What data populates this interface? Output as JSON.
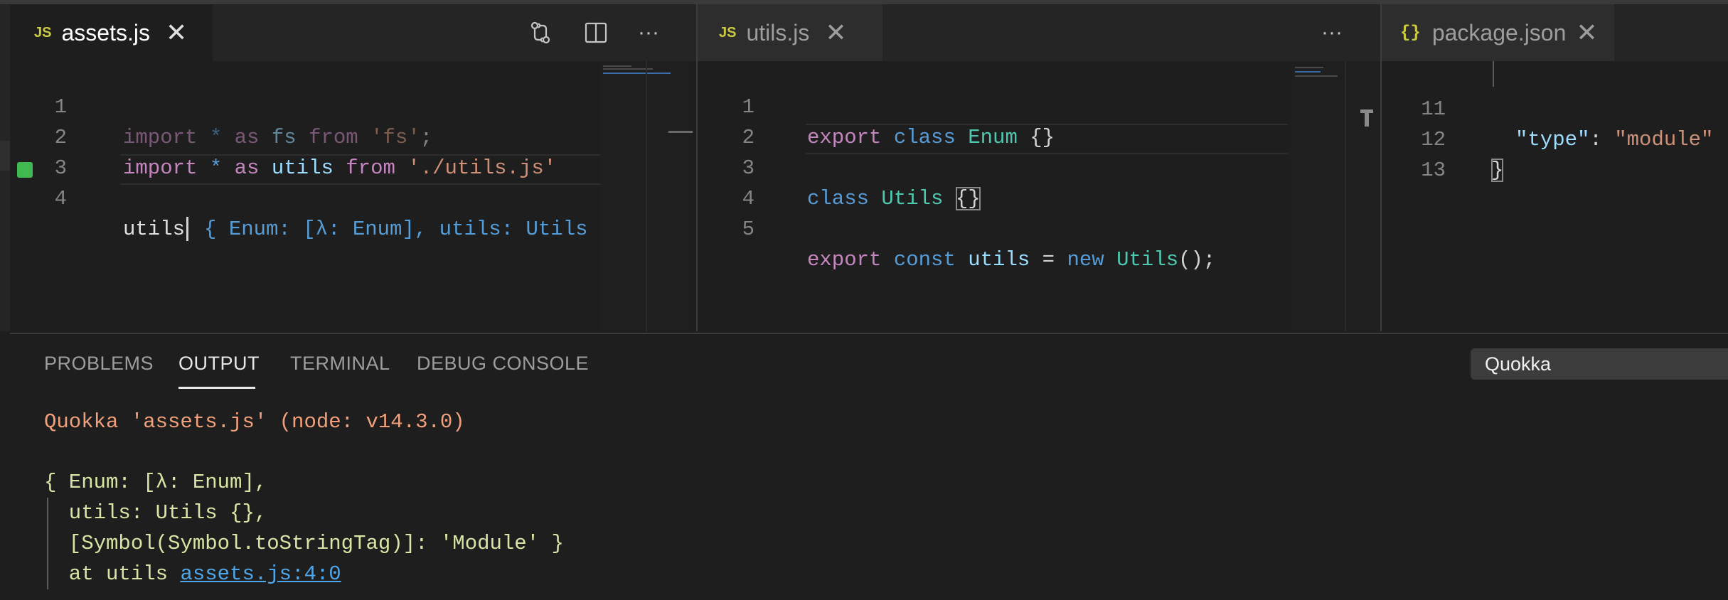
{
  "editor_a": {
    "tab": {
      "icon": "JS",
      "label": "assets.js",
      "close": "✕"
    },
    "actions": {
      "compare": "⇄",
      "split": "split-editor",
      "more": "···"
    },
    "lines": [
      {
        "n": "1"
      },
      {
        "n": "2"
      },
      {
        "n": "3"
      },
      {
        "n": "4"
      }
    ],
    "tokens": {
      "l1_import": "import",
      "l1_star": "*",
      "l1_as": "as",
      "l1_fs": "fs",
      "l1_from": "from",
      "l1_str": "'fs'",
      "l1_semi": ";",
      "l2_import": "import",
      "l2_star": "*",
      "l2_as": "as",
      "l2_utils": "utils",
      "l2_from": "from",
      "l2_str": "'./utils.js'",
      "l4_utils": "utils",
      "l4_hint": "{ Enum: [λ: Enum], utils: Utils"
    }
  },
  "editor_b": {
    "tab": {
      "icon": "JS",
      "label": "utils.js",
      "close": "✕"
    },
    "actions": {
      "more": "···"
    },
    "lines": [
      {
        "n": "1"
      },
      {
        "n": "2"
      },
      {
        "n": "3"
      },
      {
        "n": "4"
      },
      {
        "n": "5"
      }
    ],
    "tokens": {
      "l1_export": "export",
      "l1_class": "class",
      "l1_enum": "Enum",
      "l1_braces": "{}",
      "l3_class": "class",
      "l3_utils": "Utils",
      "l3_braces": "{}",
      "l5_export": "export",
      "l5_const": "const",
      "l5_utils": "utils",
      "l5_eq": "=",
      "l5_new": "new",
      "l5_Utils": "Utils",
      "l5_call": "();"
    }
  },
  "editor_c": {
    "tab": {
      "icon": "{}",
      "label": "package.json",
      "close": "✕"
    },
    "lines": [
      {
        "n": "11"
      },
      {
        "n": "12"
      },
      {
        "n": "13"
      }
    ],
    "tokens": {
      "l11_key": "\"type\"",
      "l11_colon": ":",
      "l11_val": "\"module\"",
      "l12_brace": "}"
    }
  },
  "panel": {
    "tabs": [
      "PROBLEMS",
      "OUTPUT",
      "TERMINAL",
      "DEBUG CONSOLE"
    ],
    "active_tab": "OUTPUT",
    "channel": "Quokka",
    "output": {
      "header": "Quokka 'assets.js' (node: v14.3.0)",
      "line1": "{ Enum: [λ: Enum],",
      "line2": "  utils: Utils {},",
      "line3": "  [Symbol(Symbol.toStringTag)]: 'Module' }",
      "line4_prefix": "  at utils ",
      "line4_link": "assets.js:4:0"
    }
  },
  "colors": {
    "background": "#1e1e1e",
    "keyword": "#c586c0",
    "storage": "#569cd6",
    "identifier": "#9cdcfe",
    "class": "#4ec9b0",
    "string": "#ce9178",
    "output_header": "#f0a07a",
    "output_text": "#d7e6a4",
    "link": "#4ea6ea",
    "gutter_marker": "#3fb950"
  }
}
